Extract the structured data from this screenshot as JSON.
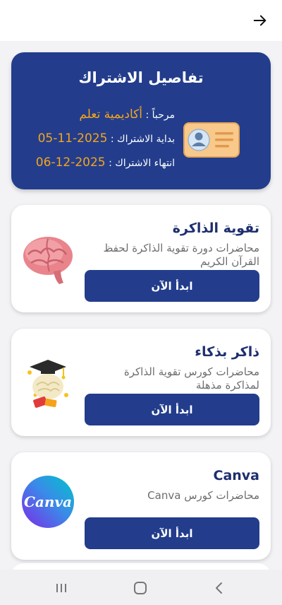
{
  "subscription": {
    "title": "تفاصيل الاشتراك",
    "welcome_label": "مرحباً :",
    "welcome_value": "أكاديمية تعلم",
    "start_label": "بداية الاشتراك :",
    "start_value": "2025-11-05",
    "end_label": "انتهاء الاشتراك :",
    "end_value": "2025-12-06"
  },
  "courses": [
    {
      "title": "تقوية الذاكرة",
      "description": "محاضرات دورة تقوية الذاكرة لحفظ القرآن الكريم",
      "button": "ابدأ الآن",
      "icon": "brain-icon"
    },
    {
      "title": "ذاكر بذكاء",
      "description": "محاضرات كورس تقوية الذاكرة لمذاكرة مذهلة",
      "button": "ابدأ الآن",
      "icon": "graduation-brain-icon"
    },
    {
      "title": "Canva",
      "description": "محاضرات كورس Canva",
      "button": "ابدأ الآن",
      "icon": "canva-logo-icon",
      "logo_text": "Canva"
    }
  ],
  "colors": {
    "primary": "#233d8c",
    "accent": "#f4a51c",
    "background": "#f3f3f5"
  },
  "icons": {
    "back": "arrow-right-icon",
    "nav": [
      "recent-apps-icon",
      "home-icon",
      "back-chevron-icon"
    ]
  }
}
